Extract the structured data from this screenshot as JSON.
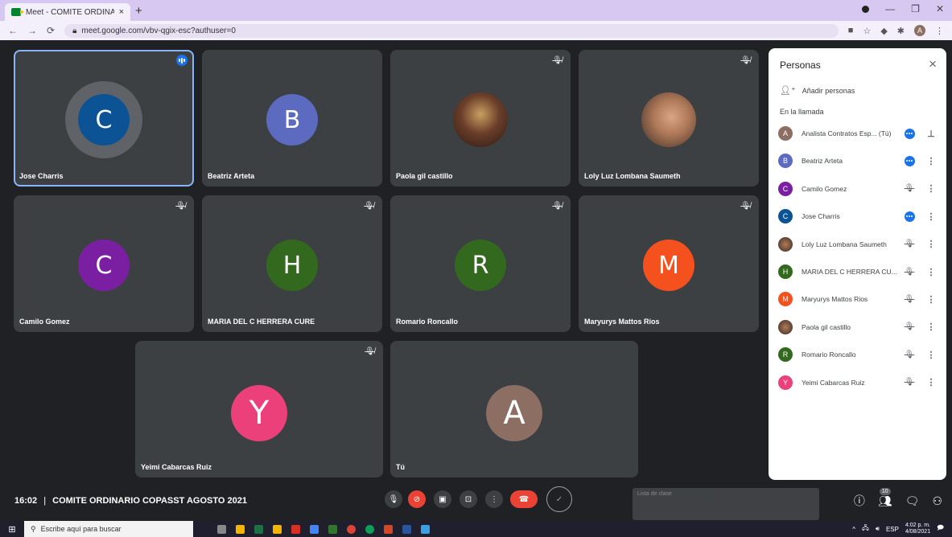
{
  "browser": {
    "tab_title": "Meet - COMITE ORDINARIO",
    "tab_close": "×",
    "new_tab": "+",
    "url": "meet.google.com/vbv-qgix-esc?authuser=0",
    "profile_initial": "A"
  },
  "tiles": [
    {
      "name": "Jose Charris",
      "initial": "C",
      "color": "#0b5394"
    },
    {
      "name": "Beatriz Arteta",
      "initial": "B",
      "color": "#5c6bc0"
    },
    {
      "name": "Paola gil castillo",
      "initial": "",
      "color": "#6d4c41"
    },
    {
      "name": "Loly Luz Lombana Saumeth",
      "initial": "",
      "color": "#a1887f"
    },
    {
      "name": "Camilo Gomez",
      "initial": "C",
      "color": "#7b1fa2"
    },
    {
      "name": "MARIA DEL C HERRERA CURE",
      "initial": "H",
      "color": "#33691e"
    },
    {
      "name": "Romario Roncallo",
      "initial": "R",
      "color": "#33691e"
    },
    {
      "name": "Maryurys Mattos Rios",
      "initial": "M",
      "color": "#f4511e"
    },
    {
      "name": "Yeimi Cabarcas Ruiz",
      "initial": "Y",
      "color": "#ec407a"
    },
    {
      "name": "Tú",
      "initial": "A",
      "color": "#8d6e63"
    }
  ],
  "panel": {
    "title": "Personas",
    "close": "×",
    "add_label": "Añadir personas",
    "section": "En la llamada",
    "people": [
      {
        "name": "Analista Contratos Esp... (Tú)",
        "initial": "A",
        "color": "#8d6e63",
        "status": "more",
        "action": "pin"
      },
      {
        "name": "Beatriz Arteta",
        "initial": "B",
        "color": "#5c6bc0",
        "status": "more",
        "action": "dots"
      },
      {
        "name": "Camilo Gomez",
        "initial": "C",
        "color": "#7b1fa2",
        "status": "muted",
        "action": "dots"
      },
      {
        "name": "Jose Charris",
        "initial": "C",
        "color": "#0b5394",
        "status": "speaking",
        "action": "dots"
      },
      {
        "name": "Loly Luz Lombana Saumeth",
        "initial": "",
        "color": "#a1887f",
        "status": "muted",
        "action": "dots"
      },
      {
        "name": "MARIA DEL C HERRERA CU...",
        "initial": "H",
        "color": "#33691e",
        "status": "muted",
        "action": "dots"
      },
      {
        "name": "Maryurys Mattos Rios",
        "initial": "M",
        "color": "#f4511e",
        "status": "muted",
        "action": "dots"
      },
      {
        "name": "Paola gil castillo",
        "initial": "",
        "color": "#5d4037",
        "status": "muted",
        "action": "dots"
      },
      {
        "name": "Romario Roncallo",
        "initial": "R",
        "color": "#33691e",
        "status": "muted",
        "action": "dots"
      },
      {
        "name": "Yeimi Cabarcas Ruiz",
        "initial": "Y",
        "color": "#ec407a",
        "status": "muted",
        "action": "dots"
      }
    ]
  },
  "meeting": {
    "time": "16:02",
    "separator": "|",
    "title": "COMITE ORDINARIO COPASST AGOSTO 2021"
  },
  "participant_count": "10",
  "overlay_text": "Lista de clase",
  "taskbar": {
    "search_placeholder": "Escribe aquí para buscar",
    "lang": "ESP",
    "time": "4:02 p. m.",
    "date": "4/08/2021"
  }
}
